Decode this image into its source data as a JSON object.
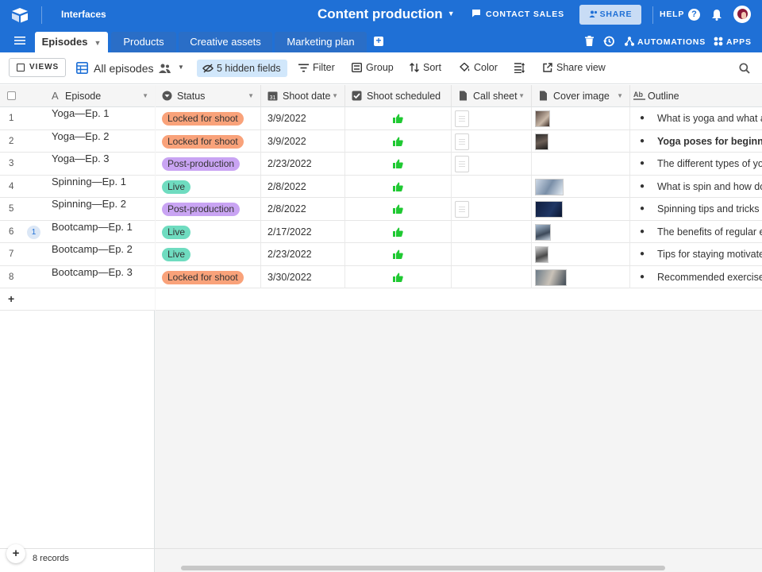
{
  "topbar": {
    "interfaces_label": "Interfaces",
    "base_title": "Content production",
    "contact_sales": "CONTACT SALES",
    "share": "SHARE",
    "help": "HELP",
    "help_icon": "?",
    "brand_color": "#1f70d6"
  },
  "tabs": [
    {
      "label": "Episodes",
      "active": true
    },
    {
      "label": "Products"
    },
    {
      "label": "Creative assets"
    },
    {
      "label": "Marketing plan"
    }
  ],
  "tabbar": {
    "add_icon": "+",
    "automations": "AUTOMATIONS",
    "apps": "APPS"
  },
  "viewbar": {
    "views": "VIEWS",
    "view_name": "All episodes",
    "hidden_fields": "5 hidden fields",
    "filter": "Filter",
    "group": "Group",
    "sort": "Sort",
    "color": "Color",
    "share_view": "Share view"
  },
  "columns": {
    "episode": "Episode",
    "status": "Status",
    "shoot_date": "Shoot date",
    "shoot_scheduled": "Shoot scheduled",
    "call_sheet": "Call sheet",
    "cover_image": "Cover image",
    "outline": "Outline"
  },
  "status_colors": {
    "Locked for shoot": "#f9a27a",
    "Post-production": "#c9a4f3",
    "Live": "#6fdcc0"
  },
  "rows": [
    {
      "num": "1",
      "episode": "Yoga—Ep. 1",
      "status": "Locked for shoot",
      "date": "3/9/2022",
      "scheduled": true,
      "call_sheet": true,
      "cover": "dark-a",
      "outline": "What is yoga and what are",
      "bold": false,
      "comments": ""
    },
    {
      "num": "2",
      "episode": "Yoga—Ep. 2",
      "status": "Locked for shoot",
      "date": "3/9/2022",
      "scheduled": true,
      "call_sheet": true,
      "cover": "dark-b",
      "outline": "Yoga poses for beginners",
      "bold": true,
      "comments": ""
    },
    {
      "num": "3",
      "episode": "Yoga—Ep. 3",
      "status": "Post-production",
      "date": "2/23/2022",
      "scheduled": true,
      "call_sheet": true,
      "cover": "",
      "outline": "The different types of yoga",
      "bold": false,
      "comments": ""
    },
    {
      "num": "4",
      "episode": "Spinning—Ep. 1",
      "status": "Live",
      "date": "2/8/2022",
      "scheduled": true,
      "call_sheet": false,
      "cover": "light-wide",
      "outline": "What is spin and how does",
      "bold": false,
      "comments": ""
    },
    {
      "num": "5",
      "episode": "Spinning—Ep. 2",
      "status": "Post-production",
      "date": "2/8/2022",
      "scheduled": true,
      "call_sheet": true,
      "cover": "navy-wide",
      "outline": "Spinning tips and tricks",
      "bold": false,
      "comments": ""
    },
    {
      "num": "6",
      "episode": "Bootcamp—Ep. 1",
      "status": "Live",
      "date": "2/17/2022",
      "scheduled": true,
      "call_sheet": false,
      "cover": "mid",
      "outline": "The benefits of regular exe",
      "bold": false,
      "comments": "1"
    },
    {
      "num": "7",
      "episode": "Bootcamp—Ep. 2",
      "status": "Live",
      "date": "2/23/2022",
      "scheduled": true,
      "call_sheet": false,
      "cover": "grey",
      "outline": "Tips for staying motivated",
      "bold": false,
      "comments": ""
    },
    {
      "num": "8",
      "episode": "Bootcamp—Ep. 3",
      "status": "Locked for shoot",
      "date": "3/30/2022",
      "scheduled": true,
      "call_sheet": false,
      "cover": "wide-b",
      "outline": "Recommended exercises fo",
      "bold": false,
      "comments": ""
    }
  ],
  "add_row": "+",
  "footer": {
    "add": "+",
    "records": "8 records"
  }
}
